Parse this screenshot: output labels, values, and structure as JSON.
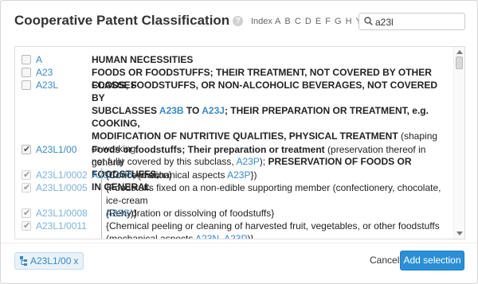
{
  "dialog": {
    "title": "Cooperative Patent Classification",
    "help_icon": "question-circle-icon",
    "index_label": "Index",
    "index_letters": [
      "A",
      "B",
      "C",
      "D",
      "E",
      "F",
      "G",
      "H",
      "Y"
    ],
    "search": {
      "value": "a23l",
      "icon": "search-icon"
    }
  },
  "tree": {
    "rows": [
      {
        "code": "A",
        "checked": false,
        "desc": "HUMAN NECESSITIES"
      },
      {
        "code": "A23",
        "checked": false,
        "desc": "FOODS OR FOODSTUFFS; THEIR TREATMENT, NOT COVERED BY OTHER CLASSES"
      },
      {
        "code": "A23L",
        "checked": false,
        "desc_line1": "FOODS, FOODSTUFFS, OR NON-ALCOHOLIC BEVERAGES, NOT COVERED BY",
        "desc_line2_a": "SUBCLASSES ",
        "desc_line2_link1": "A23B",
        "desc_line2_b": " TO ",
        "desc_line2_link2": "A23J",
        "desc_line2_c": "; THEIR PREPARATION OR TREATMENT, e.g. COOKING,",
        "desc_line3": "MODIFICATION OF NUTRITIVE QUALITIES, PHYSICAL TREATMENT",
        "desc_line3_paren": " (shaping or working,",
        "desc_line4_a": "not fully covered by this subclass, ",
        "desc_line4_link": "A23P",
        "desc_line4_b": ");",
        "desc_line4_c": " PRESERVATION OF FOODS OR FOODSTUFFS,",
        "desc_line5": "IN GENERAL"
      },
      {
        "code": "A23L1/00",
        "checked": true,
        "desc_bold": "Foods or foodstuffs; Their preparation or treatment",
        "desc_rest": " (preservation thereof in general",
        "desc_line2_link1": "A23L3/00",
        "desc_line2_a": "; {mechanical aspects ",
        "desc_line2_link2": "A23P",
        "desc_line2_b": "})"
      },
      {
        "code": "A23L1/0002",
        "checked": true,
        "desc": "{Concentration}"
      },
      {
        "code": "A23L1/0005",
        "checked": true,
        "desc_line1": "{Foodstuffs fixed on a non-edible supporting member (confectionery, chocolate, ice-cream",
        "desc_line2_link": "A23G",
        "desc_line2_b": ")}"
      },
      {
        "code": "A23L1/0008",
        "checked": true,
        "desc": "{Rehydration or dissolving of foodstuffs}"
      },
      {
        "code": "A23L1/0011",
        "checked": true,
        "desc_line1": "{Chemical peeling or cleaning of harvested fruit, vegetables, or other foodstuffs",
        "desc_line2_a": "(mechanical aspects ",
        "desc_line2_link1": "A23N",
        "desc_line2_b": ", ",
        "desc_line2_link2": "A23P",
        "desc_line2_c": ")}"
      }
    ]
  },
  "footer": {
    "chip_label": "A23L1/00",
    "chip_close": "x",
    "chip_icon": "hierarchy-icon",
    "cancel_label": "Cancel",
    "add_label": "Add selection"
  }
}
